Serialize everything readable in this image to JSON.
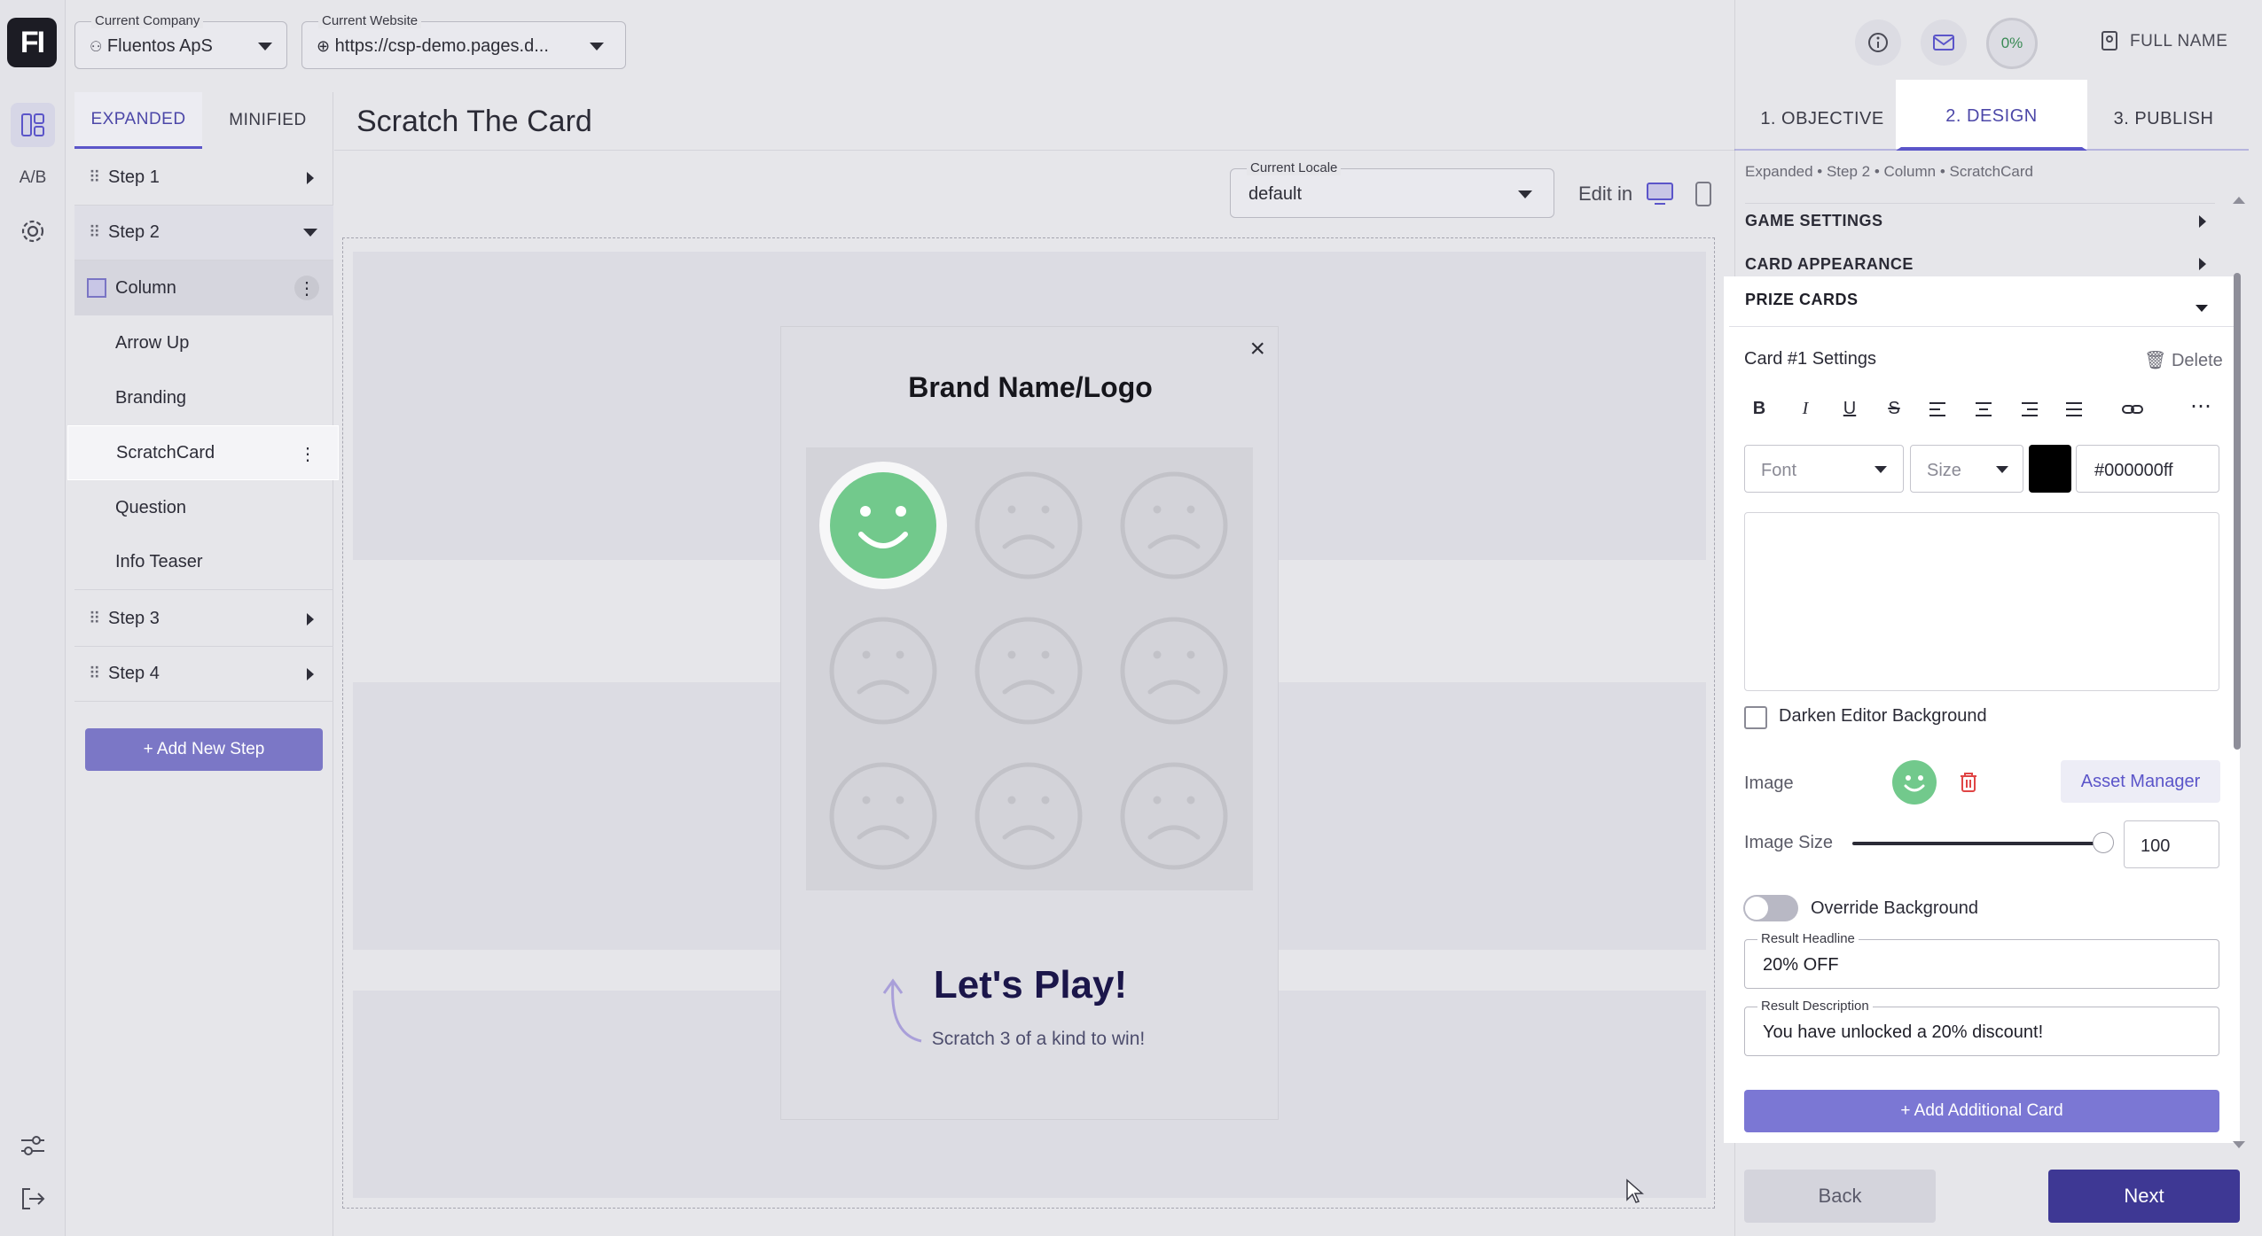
{
  "app": {
    "logo_text": "FI"
  },
  "rail": {
    "ab_label": "A/B"
  },
  "header": {
    "company": {
      "label": "Current Company",
      "value": "Fluentos ApS"
    },
    "website": {
      "label": "Current Website",
      "value": "https://csp-demo.pages.d..."
    },
    "progress": "0%",
    "user": "FULL NAME"
  },
  "steps": {
    "tabs": [
      "EXPANDED",
      "MINIFIED"
    ],
    "items": [
      {
        "label": "Step 1"
      },
      {
        "label": "Step 2"
      },
      {
        "label": "Column"
      },
      {
        "label": "Arrow Up"
      },
      {
        "label": "Branding"
      },
      {
        "label": "ScratchCard"
      },
      {
        "label": "Question"
      },
      {
        "label": "Info Teaser"
      },
      {
        "label": "Step 3"
      },
      {
        "label": "Step 4"
      }
    ],
    "add_step": "+ Add New Step"
  },
  "canvas": {
    "title": "Scratch The Card",
    "locale": {
      "label": "Current Locale",
      "value": "default"
    },
    "edit_in": "Edit in",
    "preview": {
      "close": "×",
      "brand": "Brand Name/Logo",
      "headline": "Let's Play!",
      "subtext": "Scratch 3 of a kind to win!"
    }
  },
  "wizard": {
    "tabs": [
      "1. OBJECTIVE",
      "2. DESIGN",
      "3. PUBLISH"
    ],
    "breadcrumb": "Expanded  •  Step 2  •  Column  •  ScratchCard",
    "sections": [
      "GAME SETTINGS",
      "CARD APPEARANCE",
      "PRIZE CARDS"
    ],
    "card_settings": "Card #1 Settings",
    "delete": "Delete",
    "toolbar": [
      "B",
      "I",
      "U",
      "S"
    ],
    "font_placeholder": "Font",
    "size_placeholder": "Size",
    "color_value": "#000000ff",
    "darken_label": "Darken Editor Background",
    "image_label": "Image",
    "asset_manager": "Asset Manager",
    "image_size_label": "Image Size",
    "image_size_value": "100",
    "image_size_fraction": 1.0,
    "override_bg": "Override Background",
    "result_headline": {
      "label": "Result Headline",
      "value": "20% OFF"
    },
    "result_description": {
      "label": "Result Description",
      "value": "You have unlocked a 20% discount!"
    },
    "add_card": "+ Add Additional Card",
    "back": "Back",
    "next": "Next"
  }
}
